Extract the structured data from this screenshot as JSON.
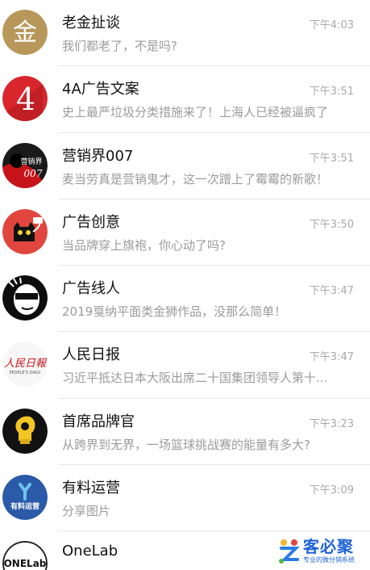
{
  "chats": [
    {
      "name": "老金扯谈",
      "time": "下午4:03",
      "message": "我们都老了，不是吗?",
      "avatar_icon": "gold-seal-logo-icon",
      "avatar_text": "金"
    },
    {
      "name": "4A广告文案",
      "time": "下午3:51",
      "message": "史上最严垃圾分类措施来了！上海人已经被逼疯了",
      "avatar_icon": "red-4a-logo-icon",
      "avatar_text": "4"
    },
    {
      "name": "营销界007",
      "time": "下午3:51",
      "message": "麦当劳真是营销鬼才，这一次蹭上了霉霉的新歌！",
      "avatar_icon": "agent-silhouette-logo-icon",
      "avatar_text": "营销界"
    },
    {
      "name": "广告创意",
      "time": "下午3:50",
      "message": "当品牌穿上旗袍，你心动了吗?",
      "avatar_icon": "black-cat-logo-icon"
    },
    {
      "name": "广告线人",
      "time": "下午3:47",
      "message": "2019戛纳平面类金狮作品，没那么简单！",
      "avatar_icon": "masked-face-logo-icon"
    },
    {
      "name": "人民日报",
      "time": "下午3:47",
      "message": "习近平抵达日本大阪出席二十国集团领导人第十...",
      "avatar_icon": "peoples-daily-logo-icon",
      "avatar_text": "人民日報",
      "avatar_subtext": "PEOPLE'S DAILY"
    },
    {
      "name": "首席品牌官",
      "time": "下午3:23",
      "message": "从跨界到无界，一场篮球挑战赛的能量有多大?",
      "avatar_icon": "lightbulb-head-logo-icon"
    },
    {
      "name": "有料运营",
      "time": "下午3:09",
      "message": "分享图片",
      "avatar_icon": "youliao-logo-icon",
      "avatar_text": "有料运营"
    },
    {
      "name": "OneLab",
      "time": "",
      "message": "",
      "avatar_icon": "onelab-logo-icon",
      "avatar_text": "ONELab"
    }
  ],
  "watermark": {
    "title": "客必聚",
    "subtitle": "专业的微分销系统",
    "icon": "kebiju-logo-icon"
  },
  "colors": {
    "separator": "#e6e6e6",
    "secondary_text": "#9b9b9b",
    "time_text": "#a9a9a9",
    "watermark": "#1f63d6"
  }
}
